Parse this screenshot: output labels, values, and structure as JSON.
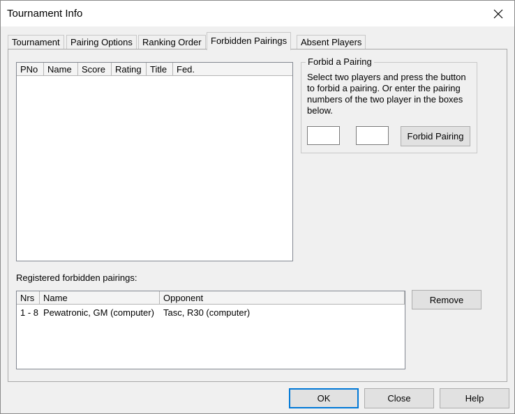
{
  "window": {
    "title": "Tournament Info"
  },
  "tabs": [
    {
      "label": "Tournament"
    },
    {
      "label": "Pairing Options"
    },
    {
      "label": "Ranking Order"
    },
    {
      "label": "Forbidden Pairings"
    },
    {
      "label": "Absent Players"
    }
  ],
  "players_list": {
    "columns": [
      "PNo",
      "Name",
      "Score",
      "Rating",
      "Title",
      "Fed."
    ]
  },
  "forbid_group": {
    "legend": "Forbid a Pairing",
    "description": "Select two players and press the button to forbid a pairing. Or enter the pairing numbers of the two player in the boxes below.",
    "player1_value": "",
    "player2_value": "",
    "forbid_button": "Forbid Pairing"
  },
  "registered": {
    "label": "Registered forbidden pairings:",
    "columns": [
      "Nrs",
      "Name",
      "Opponent"
    ],
    "rows": [
      {
        "nrs": "1 - 8",
        "name": "Pewatronic, GM (computer)",
        "opponent": "Tasc, R30 (computer)"
      }
    ],
    "remove_button": "Remove"
  },
  "footer": {
    "ok": "OK",
    "close": "Close",
    "help": "Help"
  }
}
